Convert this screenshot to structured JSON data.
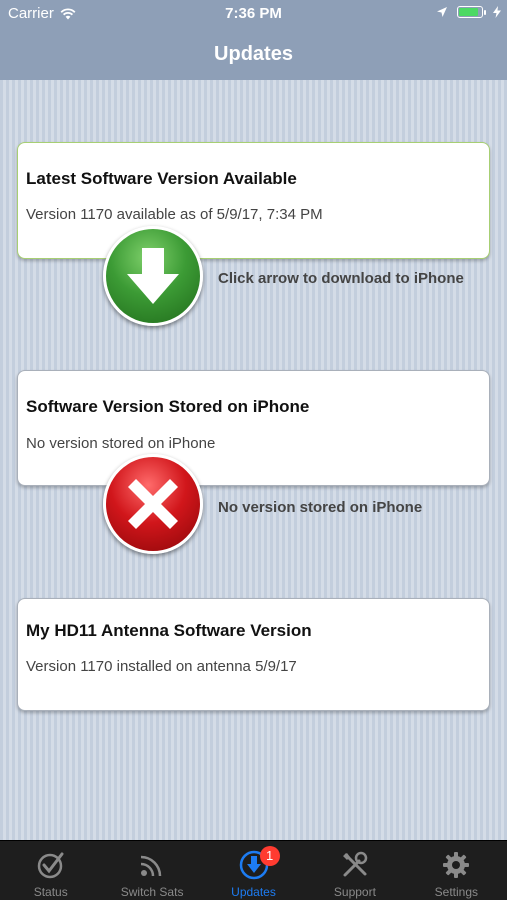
{
  "status_bar": {
    "carrier": "Carrier",
    "time": "7:36 PM",
    "battery_level": 0.9
  },
  "nav": {
    "title": "Updates"
  },
  "cards": {
    "latest": {
      "title": "Latest Software Version Available",
      "subtitle": "Version 1170 available as of 5/9/17, 7:34 PM"
    },
    "stored": {
      "title": "Software Version Stored on iPhone",
      "subtitle": "No version stored on iPhone"
    },
    "antenna": {
      "title": "My HD11 Antenna Software Version",
      "subtitle": "Version 1170 installed on antenna 5/9/17"
    }
  },
  "actions": {
    "download_caption": "Click arrow to download to iPhone",
    "stored_caption": "No version stored on iPhone",
    "download_icon": "download-arrow-icon",
    "no_version_icon": "x-mark-icon"
  },
  "tabs": [
    {
      "label": "Status",
      "icon": "checkmark-icon"
    },
    {
      "label": "Switch Sats",
      "icon": "satellite-signal-icon"
    },
    {
      "label": "Updates",
      "icon": "download-icon",
      "badge": "1"
    },
    {
      "label": "Support",
      "icon": "tools-icon"
    },
    {
      "label": "Settings",
      "icon": "gear-icon"
    }
  ],
  "colors": {
    "nav_bar": "#8e9fb7",
    "active_tab": "#1d7cf2",
    "badge": "#ff3b30",
    "download_green": "#3c9b35",
    "error_red": "#d1161b"
  }
}
